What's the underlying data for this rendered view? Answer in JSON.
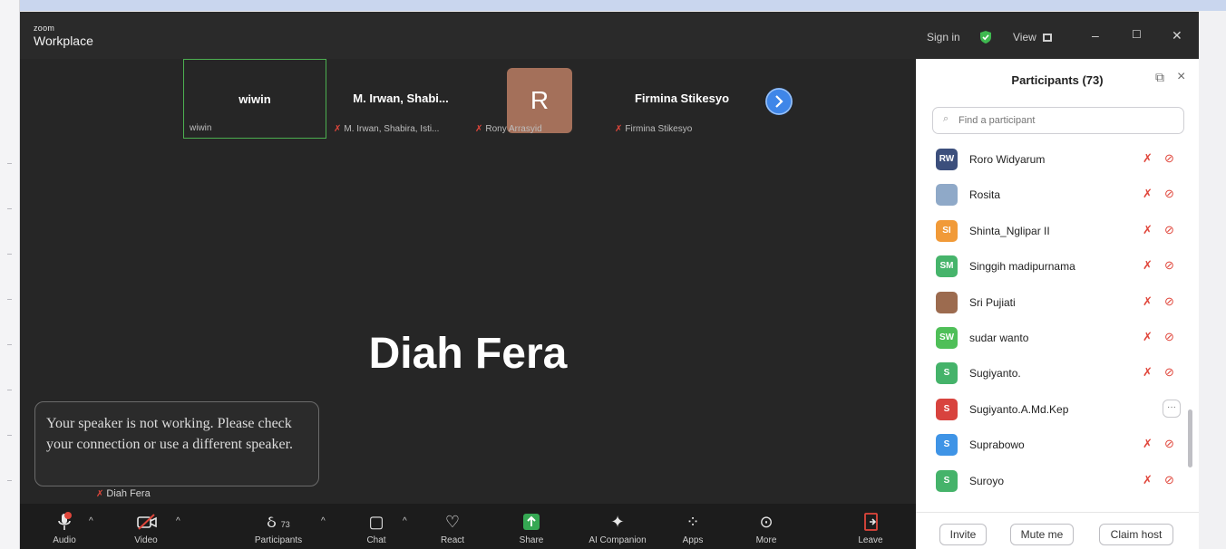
{
  "window": {
    "brand_top": "zoom",
    "brand_bottom": "Workplace",
    "sign_in": "Sign in",
    "view": "View",
    "minimize": "–",
    "maximize": "☐",
    "close": "✕"
  },
  "thumbnails": [
    {
      "display": "wiwin",
      "label": "wiwin"
    },
    {
      "display": "M. Irwan, Shabi...",
      "label": "M. Irwan, Shabira, Isti..."
    },
    {
      "display": "R",
      "label": "Rony Arrasyid"
    },
    {
      "display": "Firmina Stikesyo",
      "label": "Firmina Stikesyo"
    }
  ],
  "active_speaker": {
    "name": "Diah Fera",
    "label": "Diah Fera"
  },
  "toast": {
    "text": "Your speaker is not working. Please check your connection or use a different speaker."
  },
  "toolbar": {
    "audio": "Audio",
    "video": "Video",
    "participants": "Participants",
    "participants_count": "73",
    "chat": "Chat",
    "react": "React",
    "share": "Share",
    "ai": "AI Companion",
    "apps": "Apps",
    "more": "More",
    "leave": "Leave"
  },
  "panel": {
    "title": "Participants (73)",
    "search_placeholder": "Find a participant",
    "participants": [
      {
        "initials": "RW",
        "name": "Roro Widyarum",
        "color": "#3c4f7c"
      },
      {
        "initials": "",
        "name": "Rosita",
        "color": "#8fa9c8"
      },
      {
        "initials": "SI",
        "name": "Shinta_Nglipar II",
        "color": "#f19a38"
      },
      {
        "initials": "SM",
        "name": "Singgih madipurnama",
        "color": "#46b46b"
      },
      {
        "initials": "",
        "name": "Sri Pujiati",
        "color": "#9c6b4f"
      },
      {
        "initials": "SW",
        "name": "sudar wanto",
        "color": "#4fbf58"
      },
      {
        "initials": "S",
        "name": "Sugiyanto.",
        "color": "#45b36a"
      },
      {
        "initials": "S",
        "name": "Sugiyanto.A.Md.Kep",
        "color": "#d8433e"
      },
      {
        "initials": "S",
        "name": "Suprabowo",
        "color": "#3f94e6"
      },
      {
        "initials": "S",
        "name": "Suroyo",
        "color": "#45b36a"
      }
    ],
    "buttons": {
      "invite": "Invite",
      "mute_me": "Mute me",
      "claim_host": "Claim host"
    }
  }
}
